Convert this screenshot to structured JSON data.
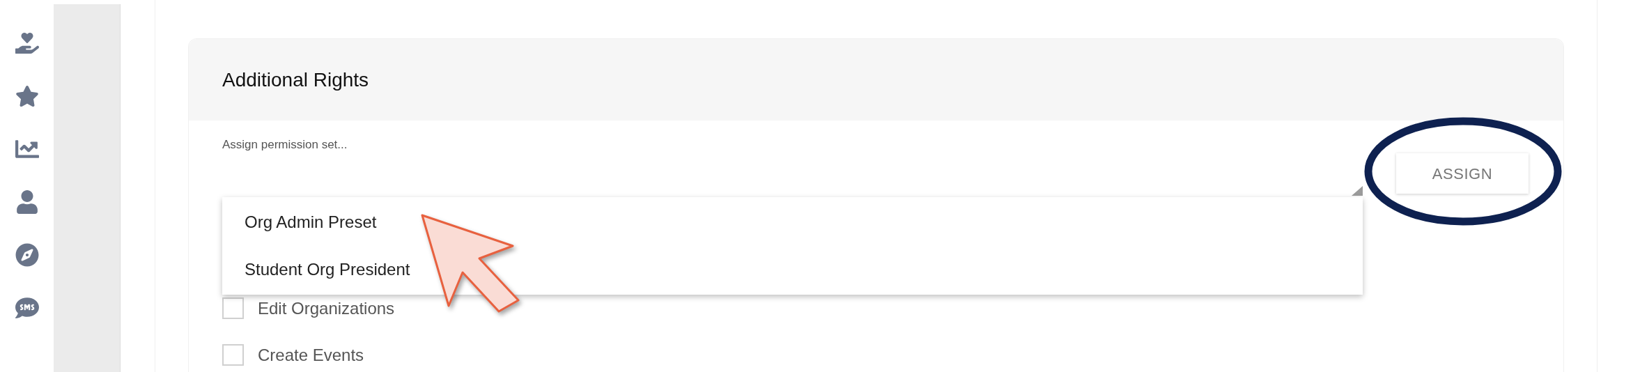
{
  "card": {
    "title": "Additional Rights",
    "select": {
      "label": "Assign permission set...",
      "expanded": true,
      "options": [
        "Org Admin Preset",
        "Student Org President"
      ]
    },
    "assign_button": "ASSIGN",
    "permissions": [
      {
        "label": "Edit Organizations",
        "checked": false
      },
      {
        "label": "Create Events",
        "checked": false
      }
    ]
  }
}
